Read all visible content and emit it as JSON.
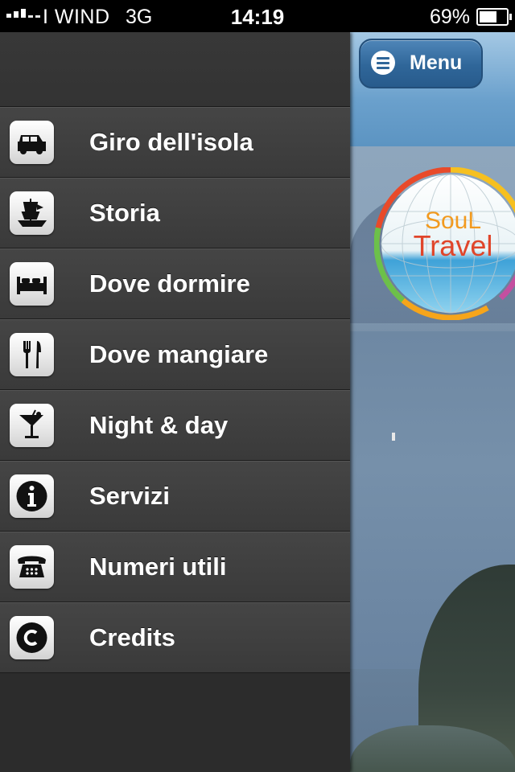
{
  "status_bar": {
    "carrier": "I WIND",
    "network": "3G",
    "time": "14:19",
    "battery_percent": "69%",
    "battery_level": 0.69
  },
  "header": {
    "menu_button_label": "Menu",
    "logo_text_line1": "SouL",
    "logo_text_line2": "Travel"
  },
  "menu": {
    "items": [
      {
        "label": "Giro dell'isola",
        "icon": "car-icon"
      },
      {
        "label": "Storia",
        "icon": "ship-icon"
      },
      {
        "label": "Dove dormire",
        "icon": "bed-icon"
      },
      {
        "label": "Dove mangiare",
        "icon": "fork-knife-icon"
      },
      {
        "label": "Night & day",
        "icon": "cocktail-icon"
      },
      {
        "label": "Servizi",
        "icon": "info-icon"
      },
      {
        "label": "Numeri utili",
        "icon": "phone-icon"
      },
      {
        "label": "Credits",
        "icon": "copyright-icon"
      }
    ]
  },
  "colors": {
    "sidebar_bg": "#2a2a2a",
    "menu_button": "#2f6699",
    "header_blue": "#6aa0cc"
  }
}
